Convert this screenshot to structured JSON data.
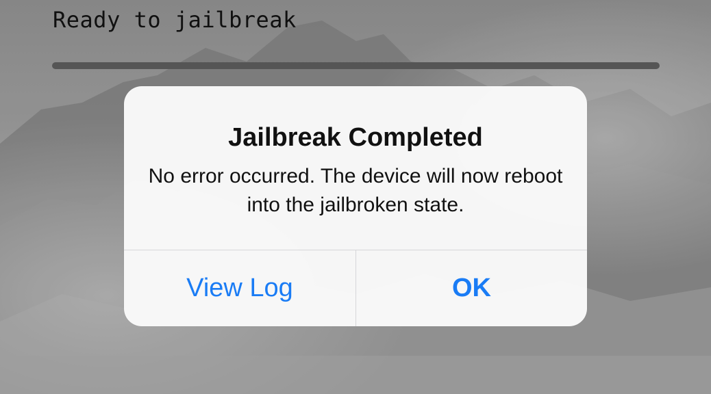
{
  "status": {
    "text": "Ready to jailbreak",
    "progress_fraction": 1.0
  },
  "alert": {
    "title": "Jailbreak Completed",
    "message": "No error occurred. The device will now reboot into the jailbroken state.",
    "buttons": {
      "view_log": "View Log",
      "ok": "OK"
    }
  },
  "colors": {
    "button_tint": "#1a7cf5",
    "progress_track": "#5b5b5b"
  }
}
